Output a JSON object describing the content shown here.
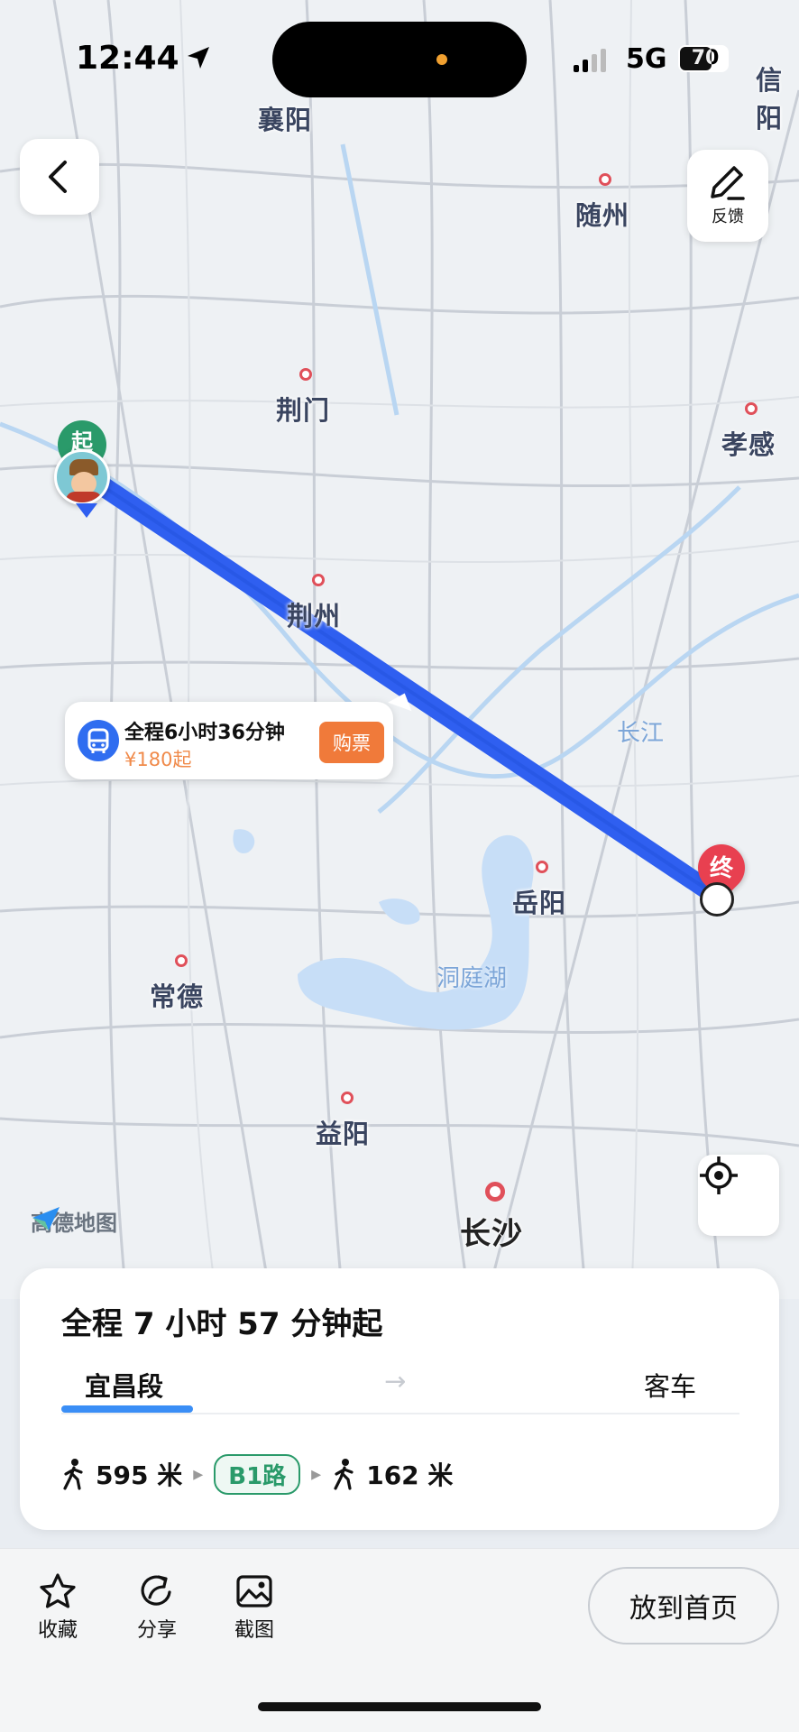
{
  "status": {
    "time": "12:44",
    "network": "5G",
    "battery": "70"
  },
  "map": {
    "cities": [
      "襄阳",
      "随州",
      "荆门",
      "孝感",
      "荆州",
      "岳阳",
      "常德",
      "益阳",
      "长沙",
      "信阳"
    ],
    "water": [
      "长江",
      "洞庭湖"
    ],
    "start_marker": "起",
    "end_marker": "终",
    "logo": "高德地图"
  },
  "buttons": {
    "feedback_label": "反馈"
  },
  "ticket": {
    "title": "全程6小时36分钟",
    "price": "¥180起",
    "buy_label": "购票"
  },
  "route": {
    "title": "全程 7 小时 57 分钟起",
    "segment_from": "宜昌段",
    "segment_arrow": "→",
    "segment_to": "客车",
    "walk1": "595 米",
    "bus_line": "B1路",
    "walk2": "162 米"
  },
  "toolbar": {
    "fav": "收藏",
    "share": "分享",
    "screenshot": "截图",
    "home": "放到首页"
  },
  "colors": {
    "route": "#2f5ff0",
    "accent": "#3a8ef6",
    "ticket_btn": "#f07a3a"
  }
}
